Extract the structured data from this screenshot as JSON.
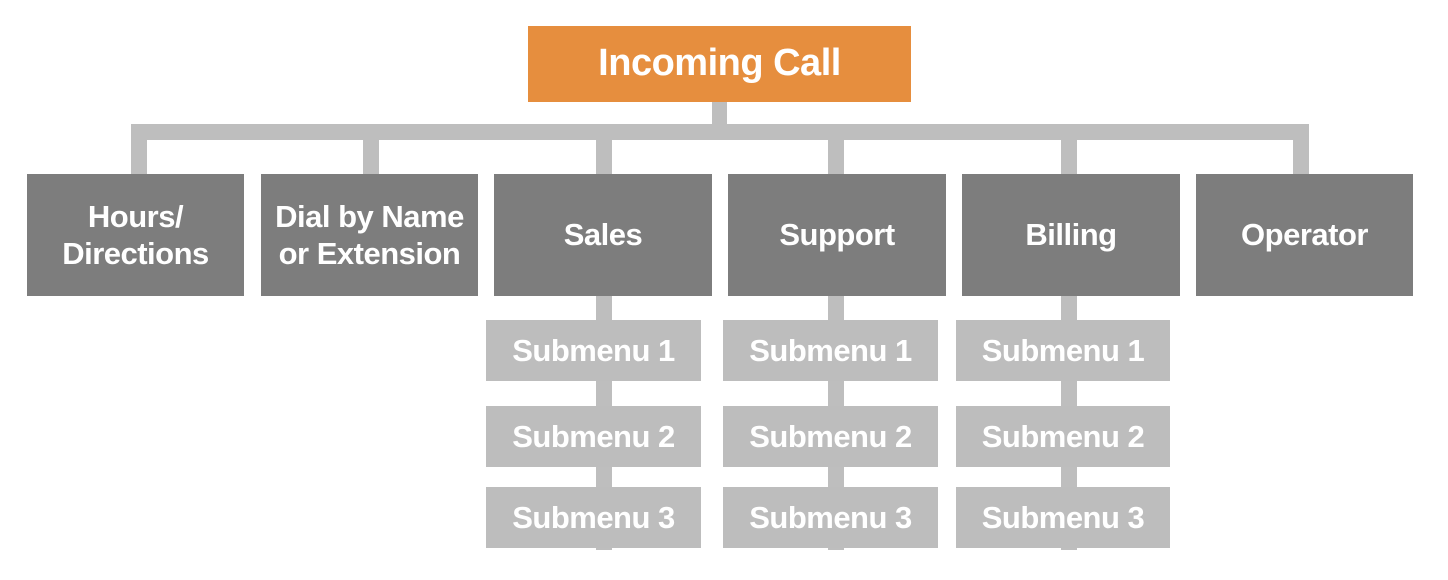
{
  "diagram": {
    "title": "Incoming Call",
    "colors": {
      "root": "#e68e3e",
      "main_option": "#7d7d7d",
      "submenu": "#bdbdbd",
      "connector": "#bebebe",
      "text": "#ffffff"
    },
    "options": [
      {
        "label_line1": "Hours/",
        "label_line2": "Directions",
        "submenus": []
      },
      {
        "label_line1": "Dial by Name",
        "label_line2": "or Extension",
        "submenus": []
      },
      {
        "label_line1": "Sales",
        "label_line2": "",
        "submenus": [
          "Submenu 1",
          "Submenu 2",
          "Submenu 3"
        ]
      },
      {
        "label_line1": "Support",
        "label_line2": "",
        "submenus": [
          "Submenu 1",
          "Submenu 2",
          "Submenu 3"
        ]
      },
      {
        "label_line1": "Billing",
        "label_line2": "",
        "submenus": [
          "Submenu 1",
          "Submenu 2",
          "Submenu 3"
        ]
      },
      {
        "label_line1": "Operator",
        "label_line2": "",
        "submenus": []
      }
    ]
  }
}
